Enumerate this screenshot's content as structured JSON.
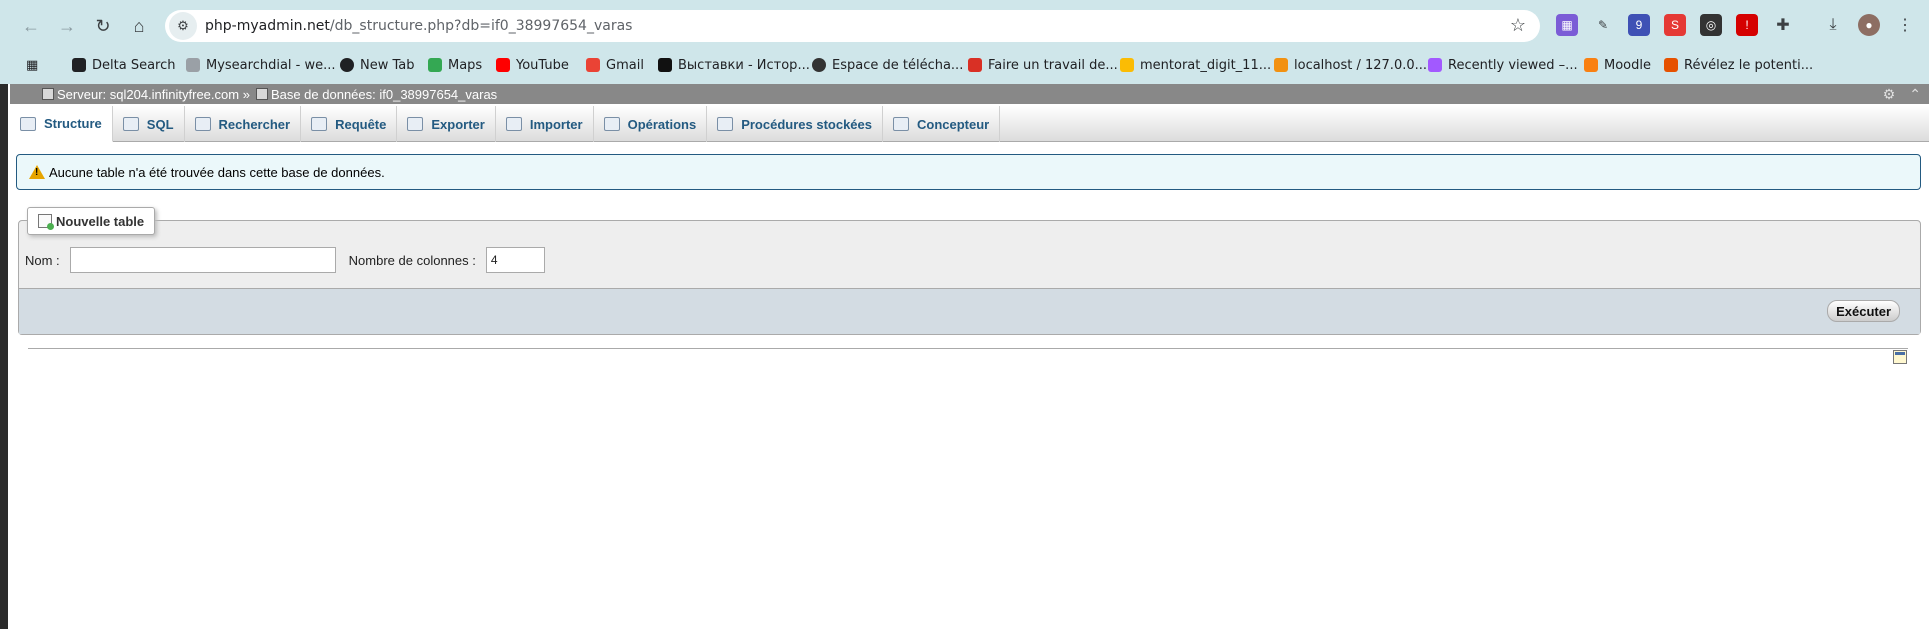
{
  "browser": {
    "url_host": "php-myadmin.net",
    "url_path": "/db_structure.php?db=if0_38997654_varas",
    "bookmarks": [
      {
        "label": "Delta Search",
        "color": "#202124"
      },
      {
        "label": "Mysearchdial - we...",
        "color": "#9aa0a6"
      },
      {
        "label": "New Tab",
        "color": "#202124"
      },
      {
        "label": "Maps",
        "color": "#34a853"
      },
      {
        "label": "YouTube",
        "color": "#ff0000"
      },
      {
        "label": "Gmail",
        "color": "#ea4335"
      },
      {
        "label": "Выставки - Истор...",
        "color": "#111111"
      },
      {
        "label": "Espace de télécha...",
        "color": "#333333"
      },
      {
        "label": "Faire un travail de...",
        "color": "#d93025"
      },
      {
        "label": "mentorat_digit_11...",
        "color": "#fbbc04"
      },
      {
        "label": "localhost / 127.0.0....",
        "color": "#f29111"
      },
      {
        "label": "Recently viewed –...",
        "color": "#a259ff"
      },
      {
        "label": "Moodle",
        "color": "#f98012"
      },
      {
        "label": "Révélez le potenti...",
        "color": "#e65100"
      }
    ],
    "extension_badge": "9"
  },
  "pma": {
    "breadcrumb_server": "Serveur: sql204.infinityfree.com »",
    "breadcrumb_db": "Base de données: if0_38997654_varas",
    "tabs": [
      {
        "label": "Structure"
      },
      {
        "label": "SQL"
      },
      {
        "label": "Rechercher"
      },
      {
        "label": "Requête"
      },
      {
        "label": "Exporter"
      },
      {
        "label": "Importer"
      },
      {
        "label": "Opérations"
      },
      {
        "label": "Procédures stockées"
      },
      {
        "label": "Concepteur"
      }
    ],
    "notice": "Aucune table n'a été trouvée dans cette base de données.",
    "new_table": {
      "legend": "Nouvelle table",
      "name_label": "Nom :",
      "name_value": "",
      "cols_label": "Nombre de colonnes :",
      "cols_value": "4",
      "submit_label": "Exécuter"
    }
  }
}
